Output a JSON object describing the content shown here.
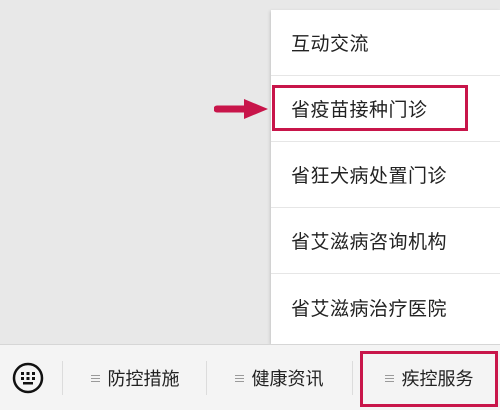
{
  "popup_menu": {
    "items": [
      {
        "label": "互动交流"
      },
      {
        "label": "省疫苗接种门诊"
      },
      {
        "label": "省狂犬病处置门诊"
      },
      {
        "label": "省艾滋病咨询机构"
      },
      {
        "label": "省艾滋病治疗医院"
      }
    ]
  },
  "bottom_bar": {
    "keyboard_icon": "keyboard-icon",
    "tabs": [
      {
        "label": "防控措施",
        "icon": "menu-icon"
      },
      {
        "label": "健康资讯",
        "icon": "menu-icon"
      },
      {
        "label": "疾控服务",
        "icon": "menu-icon"
      }
    ]
  },
  "annotation": {
    "highlight_color": "#c8154a",
    "arrow_icon": "arrow-right-icon"
  }
}
